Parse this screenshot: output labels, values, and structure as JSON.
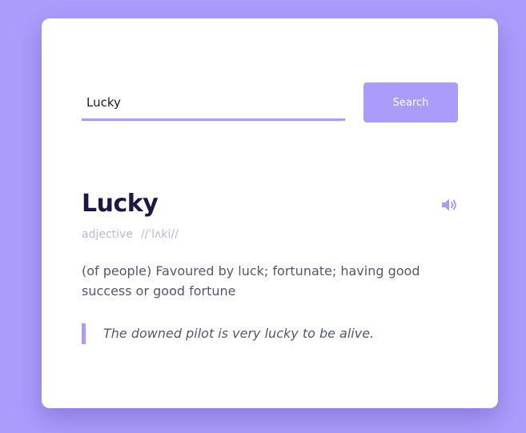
{
  "search": {
    "value": "Lucky",
    "button_label": "Search"
  },
  "entry": {
    "word": "Lucky",
    "part_of_speech": "adjective",
    "phonetic": "//ˈlʌki//",
    "definition": "(of people) Favoured by luck; fortunate; having good success or good fortune",
    "example": "The downed pilot is very lucky to be alive."
  },
  "icons": {
    "audio": "speaker-volume-icon"
  },
  "colors": {
    "background": "#ab9cfc",
    "accent": "#ab9cfc",
    "card": "#ffffff",
    "word": "#1c1747",
    "muted": "#bdb6d6",
    "text": "#575670"
  }
}
